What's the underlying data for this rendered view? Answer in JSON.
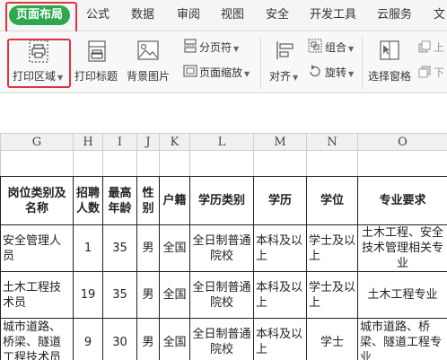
{
  "tabs": [
    "页面布局",
    "公式",
    "数据",
    "审阅",
    "视图",
    "安全",
    "开发工具",
    "云服务",
    "文"
  ],
  "toolbar": {
    "print_area": "打印区域",
    "print_titles": "打印标题",
    "background_image": "背景图片",
    "page_break": "分页符",
    "page_zoom": "页面缩放",
    "align": "对齐",
    "group": "组合",
    "rotate": "旋转",
    "selection_pane": "选择窗格",
    "bring_up": "上",
    "send_down": "下"
  },
  "sheet": {
    "columns": [
      "G",
      "H",
      "I",
      "J",
      "K",
      "L",
      "M",
      "N",
      "O"
    ],
    "header": [
      "岗位类别及名称",
      "招聘人数",
      "最高年龄",
      "性别",
      "户籍",
      "学历类别",
      "学历",
      "学位",
      "专业要求"
    ],
    "rows": [
      [
        "安全管理人员",
        "1",
        "35",
        "男",
        "全国",
        "全日制普通院校",
        "本科及以上",
        "学士及以上",
        "土木工程、安全技术管理相关专业"
      ],
      [
        "土木工程技术员",
        "19",
        "35",
        "男",
        "全国",
        "全日制普通院校",
        "本科及以上",
        "学士及以上",
        "土木工程专业"
      ],
      [
        "城市道路、桥梁、隧道工程技术员",
        "9",
        "30",
        "男",
        "全国",
        "全日制普通院校",
        "本科及以上",
        "学士",
        "城市道路、桥梁、隧道工程专业"
      ]
    ]
  },
  "colors": {
    "active_tab": "#2ea84f",
    "highlight": "#e5323a"
  }
}
